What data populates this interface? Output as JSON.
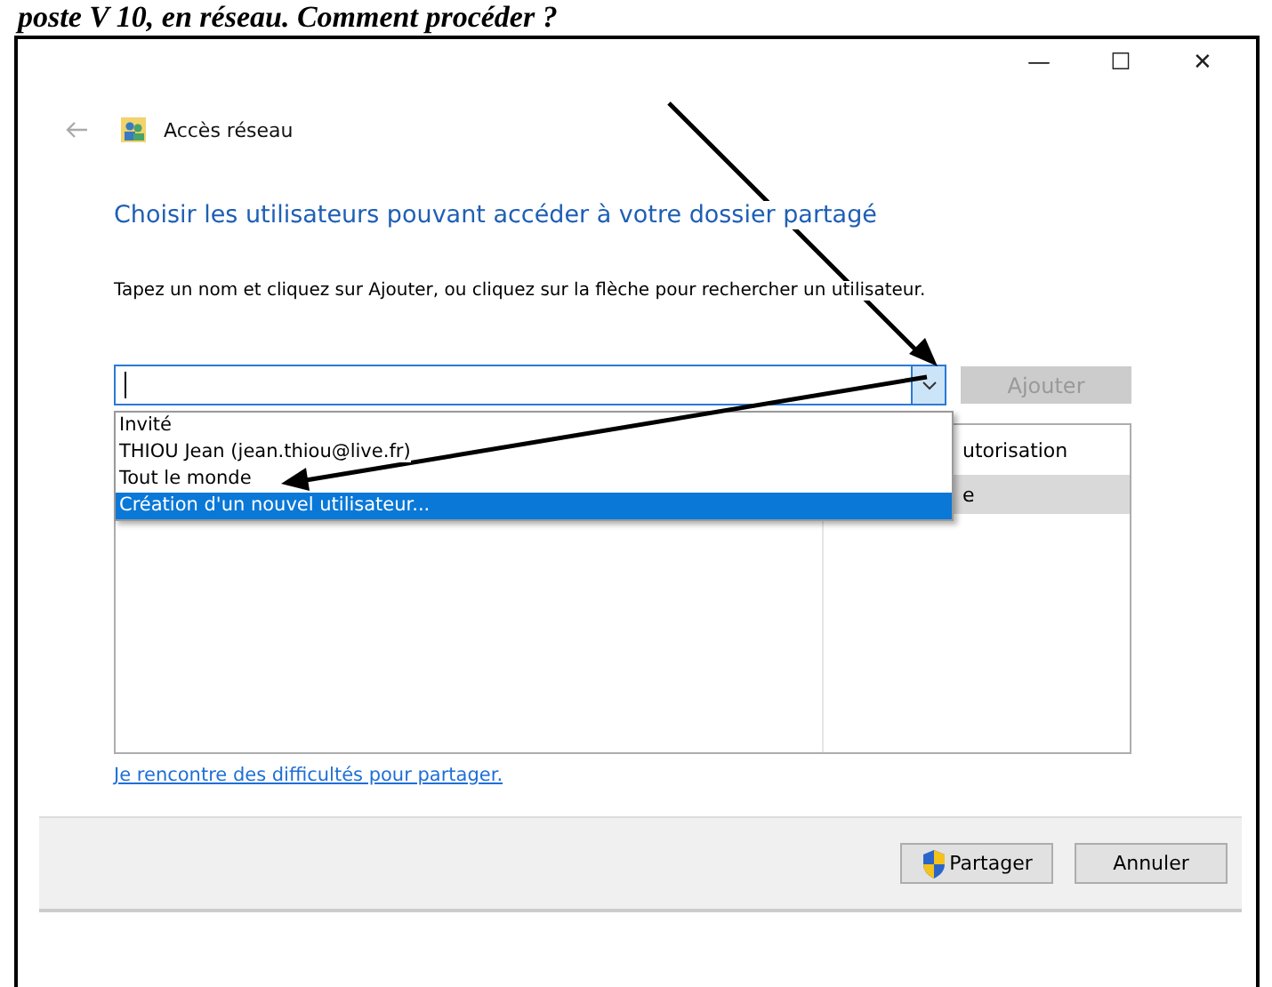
{
  "page_heading": "poste V 10, en réseau. Comment procéder ?",
  "window": {
    "title": "Accès réseau",
    "controls": [
      "—",
      "☐",
      "✕"
    ]
  },
  "heading": "Choisir les utilisateurs pouvant accéder à votre dossier partagé",
  "instruction": "Tapez un nom et cliquez sur Ajouter, ou cliquez sur la flèche pour rechercher un utilisateur.",
  "combo": {
    "expanded": true
  },
  "add_button": {
    "label": "Ajouter",
    "disabled": true
  },
  "dropdown": [
    {
      "label": "Invité",
      "selected": false
    },
    {
      "label": "THIOU Jean (jean.thiou@live.fr)",
      "selected": false
    },
    {
      "label": "Tout le monde",
      "selected": false
    },
    {
      "label": "Création d'un nouvel utilisateur...",
      "selected": true
    }
  ],
  "table": {
    "column_2": "utorisation",
    "rows": [
      {
        "column_2": "e",
        "selected": true
      }
    ]
  },
  "help_link": "Je rencontre des difficultés pour partager.",
  "buttons": [
    {
      "label": "Partager",
      "kind": "shield"
    },
    {
      "label": "Annuler",
      "kind": "plain"
    }
  ]
}
